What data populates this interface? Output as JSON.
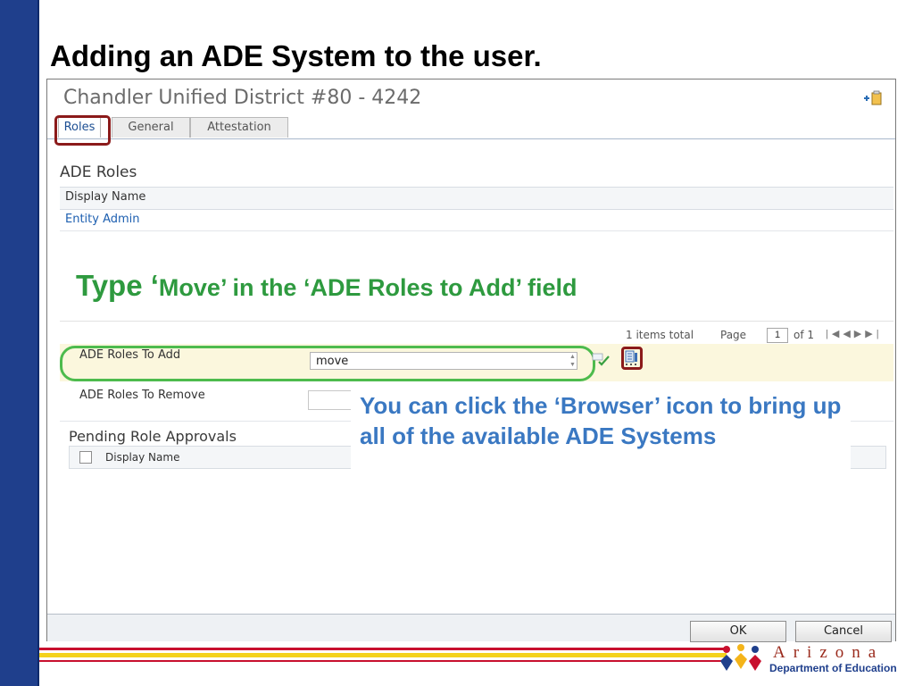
{
  "slide": {
    "title": "Adding an ADE System to the user."
  },
  "window": {
    "title": "Chandler Unified District #80 - 4242",
    "tabs": [
      {
        "label": "Roles",
        "active": true
      },
      {
        "label": "General",
        "active": false
      },
      {
        "label": "Attestation",
        "active": false
      }
    ]
  },
  "ade_roles": {
    "heading": "ADE Roles",
    "column_header": "Display Name",
    "rows": [
      "Entity Admin"
    ]
  },
  "instruction": {
    "type_word": "Type ‘",
    "rest": "Move’ in the ‘ADE Roles to Add’ field"
  },
  "pager": {
    "total": "1 items total",
    "page_label": "Page",
    "page_value": "1",
    "of_label": "of 1"
  },
  "roles_form": {
    "add_label": "ADE Roles To Add",
    "add_value": "move",
    "remove_label": "ADE Roles To Remove"
  },
  "pending": {
    "heading": "Pending Role Approvals",
    "column_header": "Display Name"
  },
  "callout": {
    "text": "You can click the ‘Browser’ icon to bring up all of the available ADE Systems"
  },
  "buttons": {
    "ok": "OK",
    "cancel": "Cancel"
  },
  "logo": {
    "arizona": "Arizona",
    "department": "Department of Education"
  },
  "colors": {
    "left_bar": "#1f3f8c",
    "instruction_green": "#2e9a3f",
    "callout_blue": "#3a78c2",
    "highlight_red": "#8b1a1a",
    "highlight_green": "#4dbb4d"
  },
  "icons": [
    "add-item-icon",
    "check-icon",
    "browser-icon",
    "pager-first-icon",
    "pager-prev-icon",
    "pager-next-icon",
    "pager-last-icon",
    "arizona-logo-icon"
  ]
}
